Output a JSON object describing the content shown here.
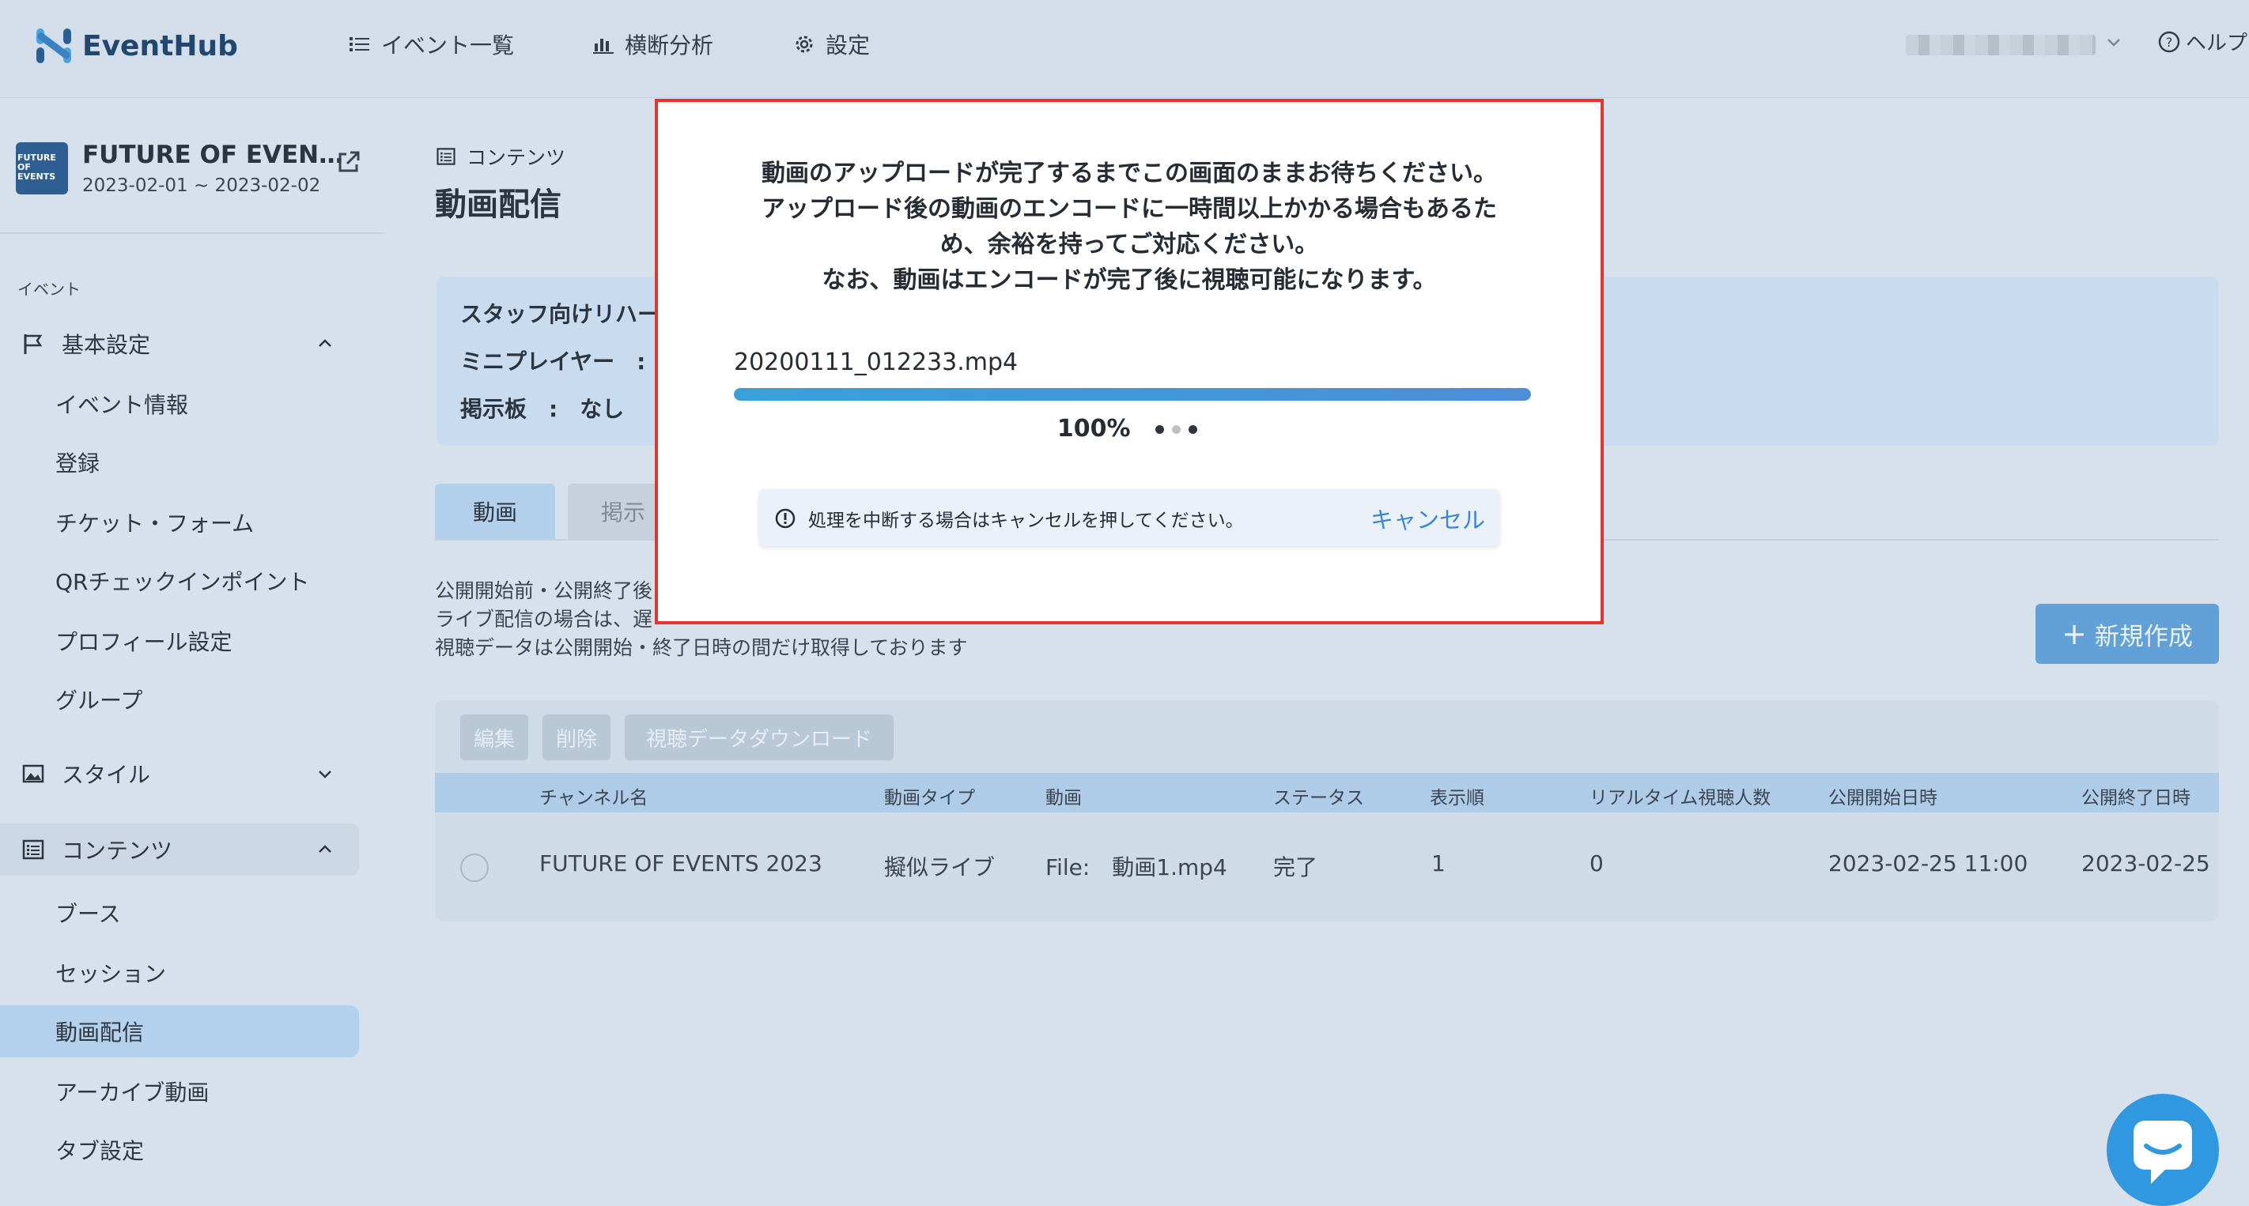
{
  "app": {
    "name": "EventHub"
  },
  "header": {
    "nav": [
      {
        "label": "イベント一覧",
        "icon": "list-icon"
      },
      {
        "label": "横断分析",
        "icon": "bar-chart-icon"
      },
      {
        "label": "設定",
        "icon": "gear-icon"
      }
    ],
    "help_label": "ヘルプ"
  },
  "sidebar": {
    "event": {
      "thumb_text": "FUTURE OF EVENTS",
      "title": "FUTURE OF EVEN…",
      "dates": "2023-02-01 ~ 2023-02-02"
    },
    "section_label": "イベント",
    "groups": {
      "basic": {
        "label": "基本設定",
        "items": [
          "イベント情報",
          "登録",
          "チケット・フォーム",
          "QRチェックインポイント",
          "プロフィール設定",
          "グループ"
        ]
      },
      "style": {
        "label": "スタイル"
      },
      "contents": {
        "label": "コンテンツ",
        "items": [
          "ブース",
          "セッション",
          "動画配信",
          "アーカイブ動画",
          "タブ設定"
        ]
      }
    }
  },
  "main": {
    "breadcrumb": "コンテンツ",
    "title": "動画配信",
    "info": {
      "line1": "スタッフ向けリハー",
      "line2": "ミニプレイヤー　:",
      "line3": "掲示板　:　なし"
    },
    "tabs": [
      "動画",
      "掲示"
    ],
    "description": [
      "公開開始前・公開終了後",
      "ライブ配信の場合は、遅",
      "視聴データは公開開始・終了日時の間だけ取得しております"
    ],
    "new_button": "新規作成",
    "table": {
      "actions": [
        "編集",
        "削除",
        "視聴データダウンロード"
      ],
      "columns": [
        "チャンネル名",
        "動画タイプ",
        "動画",
        "ステータス",
        "表示順",
        "リアルタイム視聴人数",
        "公開開始日時",
        "公開終了日時"
      ],
      "rows": [
        {
          "channel": "FUTURE OF EVENTS 2023",
          "type": "擬似ライブ",
          "video": "File:　動画1.mp4",
          "status": "完了",
          "order": "1",
          "viewers": "0",
          "start": "2023-02-25 11:00",
          "end": "2023-02-25"
        }
      ]
    }
  },
  "modal": {
    "message_lines": [
      "動画のアップロードが完了するまでこの画面のままお待ちください。",
      "アップロード後の動画のエンコードに一時間以上かかる場合もあるた",
      "め、余裕を持ってご対応ください。",
      "なお、動画はエンコードが完了後に視聴可能になります。"
    ],
    "file_name": "20200111_012233.mp4",
    "progress_fraction": 1.0,
    "progress_text": "100%",
    "notice_text": "処理を中断する場合はキャンセルを押してください。",
    "cancel_label": "キャンセル"
  },
  "colors": {
    "accent": "#3a86d6",
    "highlight_border": "#e3342f",
    "chat_button": "#2f98e1"
  }
}
